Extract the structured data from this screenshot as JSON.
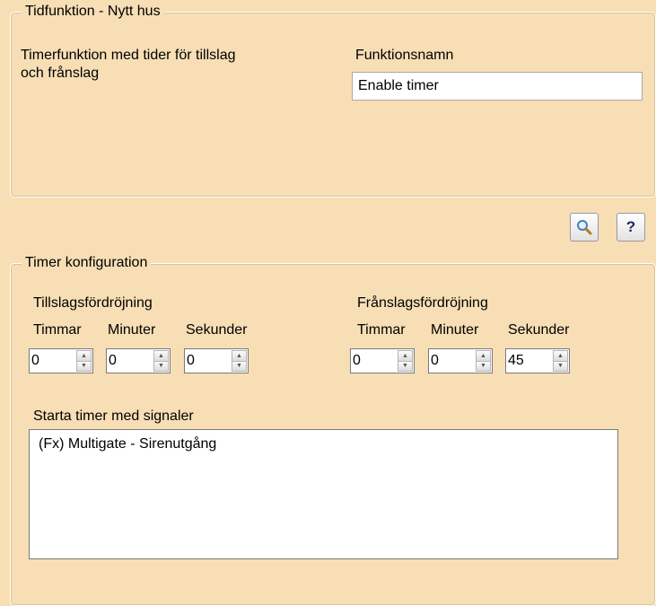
{
  "function_group": {
    "legend": "Tidfunktion - Nytt hus",
    "description_line1": "Timerfunktion med tider för tillslag",
    "description_line2": "och frånslag",
    "name_label": "Funktionsnamn",
    "name_value": "Enable timer"
  },
  "toolbar": {
    "search_icon": "magnifier-icon",
    "help_label": "?"
  },
  "timer_config": {
    "legend": "Timer konfiguration",
    "on_delay": {
      "title": "Tillslagsfördröjning",
      "hours_label": "Timmar",
      "minutes_label": "Minuter",
      "seconds_label": "Sekunder",
      "hours": "0",
      "minutes": "0",
      "seconds": "0"
    },
    "off_delay": {
      "title": "Frånslagsfördröjning",
      "hours_label": "Timmar",
      "minutes_label": "Minuter",
      "seconds_label": "Sekunder",
      "hours": "0",
      "minutes": "0",
      "seconds": "45"
    },
    "signals_label": "Starta timer med signaler",
    "signals": [
      "(Fx) Multigate - Sirenutgång"
    ]
  }
}
